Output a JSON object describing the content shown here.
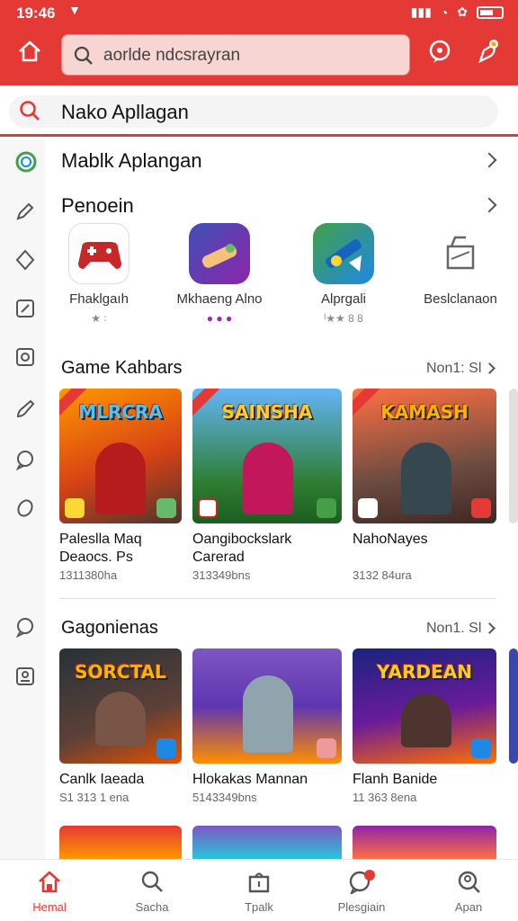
{
  "status": {
    "time": "19:46",
    "dn": "▼"
  },
  "appbar": {
    "search_placeholder": "aorlde ndcsrayran"
  },
  "search2": {
    "text": "Nako Apllagan"
  },
  "rows": {
    "first": "Mablk Aplangan",
    "second": "Penoein"
  },
  "apps": [
    {
      "name": "Fhaklgaıh",
      "meta": "★ ꞉"
    },
    {
      "name": "Mkhaeng Alno",
      "meta": "● ● ●"
    },
    {
      "name": "Alprgali",
      "meta": "ᴵ★★ 8 8"
    },
    {
      "name": "Beslclanaon",
      "meta": ""
    }
  ],
  "section1": {
    "title": "Game Kahbars",
    "more": "Non1: Sl",
    "games": [
      {
        "logo": "MLRCRA",
        "name1": "Paleslla Maq",
        "name2": "Deaocs. Ps",
        "meta": "1311380ha"
      },
      {
        "logo": "SAINSHA",
        "name1": "Oangibockslark",
        "name2": "Carerad",
        "meta": "313349bns"
      },
      {
        "logo": "KAMASH",
        "name1": "NahoNayes",
        "name2": "",
        "meta": "3132 84ura"
      }
    ]
  },
  "section2": {
    "title": "Gagonienas",
    "more": "Non1. Sl",
    "games": [
      {
        "logo": "SORCTAL",
        "name": "Canlk Iaeada",
        "meta": "S1 313 1 ena"
      },
      {
        "logo": "",
        "name": "Hlokakas Mannan",
        "meta": "5143349bns"
      },
      {
        "logo": "YARDEAN",
        "name": "Flanh Banide",
        "meta": "11 363 8ena"
      }
    ]
  },
  "bottom_nav": [
    {
      "label": "Hemal",
      "icon": "home-icon"
    },
    {
      "label": "Sacha",
      "icon": "search-icon"
    },
    {
      "label": "Tpalk",
      "icon": "bag-icon"
    },
    {
      "label": "Plesgiain",
      "icon": "chat-icon"
    },
    {
      "label": "Apan",
      "icon": "account-search-icon"
    }
  ],
  "colors": {
    "accent": "#e53935"
  }
}
